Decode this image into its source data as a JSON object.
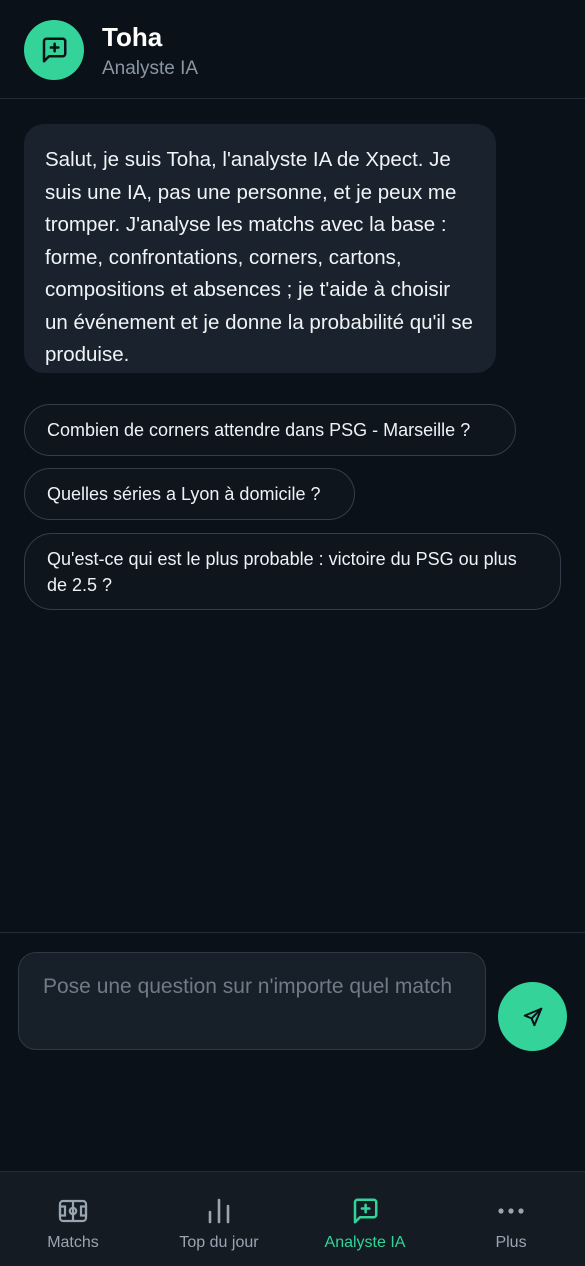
{
  "header": {
    "title": "Toha",
    "subtitle": "Analyste IA",
    "avatar_icon": "message-sparkle-icon"
  },
  "chat": {
    "messages": [
      {
        "role": "assistant",
        "text": "Salut, je suis Toha, l'analyste IA de Xpect. Je suis une IA, pas une personne, et je peux me tromper. J'analyse les matchs avec la base : forme, confrontations, corners, cartons, compositions et absences ; je t'aide à choisir un événement et je donne la probabilité qu'il se produise."
      }
    ],
    "suggestions": [
      "Combien de corners attendre dans PSG - Marseille ?",
      "Quelles séries a Lyon à domicile ?",
      "Qu'est-ce qui est le plus probable : victoire du PSG ou plus de 2.5 ?"
    ]
  },
  "composer": {
    "placeholder": "Pose une question sur n'importe quel match",
    "send_icon": "send-icon"
  },
  "nav": {
    "items": [
      {
        "label": "Matchs",
        "icon": "pitch-icon",
        "active": false
      },
      {
        "label": "Top du jour",
        "icon": "bar-chart-icon",
        "active": false
      },
      {
        "label": "Analyste IA",
        "icon": "message-sparkle-icon",
        "active": true
      },
      {
        "label": "Plus",
        "icon": "more-dots-icon",
        "active": false
      }
    ]
  },
  "colors": {
    "accent": "#34d399",
    "background": "#0b1118",
    "bubble": "#1a232d",
    "nav_background": "#141b23"
  }
}
